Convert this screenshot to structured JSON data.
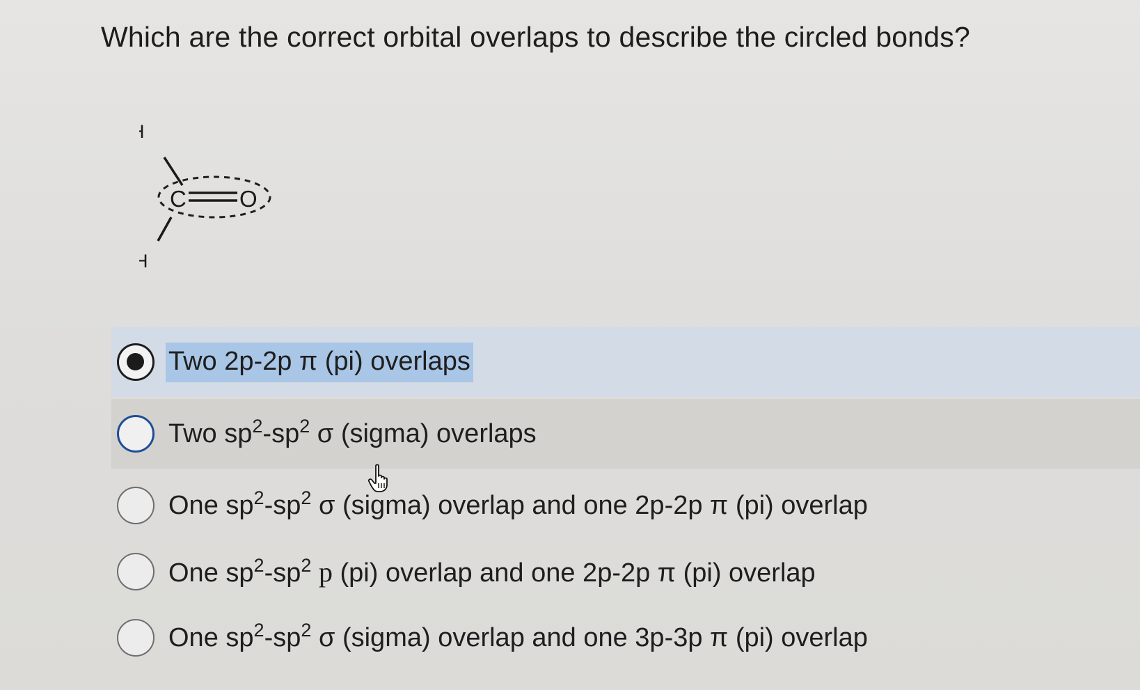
{
  "question": "Which are the correct orbital overlaps to describe the circled bonds?",
  "molecule": {
    "atoms": {
      "h_top": "H",
      "h_bottom": "H",
      "carbon": "C",
      "oxygen": "O"
    }
  },
  "options": [
    {
      "pre": "Two 2p-2p π (pi) overlaps",
      "selected": true
    },
    {
      "a": "Two sp",
      "s1": "2",
      "b": "-sp",
      "s2": "2",
      "c": " σ (sigma) overlaps",
      "selected": false
    },
    {
      "a": "One sp",
      "s1": "2",
      "b": "-sp",
      "s2": "2",
      "c": " σ (sigma) overlap and one 2p-2p π (pi) overlap",
      "selected": false
    },
    {
      "a": "One sp",
      "s1": "2",
      "b": "-sp",
      "s2": "2",
      "c1": " ",
      "p": "p",
      "c2": " (pi) overlap and one 2p-2p π (pi) overlap",
      "selected": false
    },
    {
      "a": "One sp",
      "s1": "2",
      "b": "-sp",
      "s2": "2",
      "c": " σ (sigma) overlap and one 3p-3p π (pi) overlap",
      "selected": false
    }
  ],
  "colors": {
    "selected_row": "#d3dbe6",
    "hover_row": "#d3d2cf",
    "text_highlight": "#a9c6e6",
    "focus_ring": "#1e4e96"
  },
  "icons": [
    "radio-checked-icon",
    "radio-unchecked-icon",
    "hand-pointer-cursor-icon"
  ]
}
